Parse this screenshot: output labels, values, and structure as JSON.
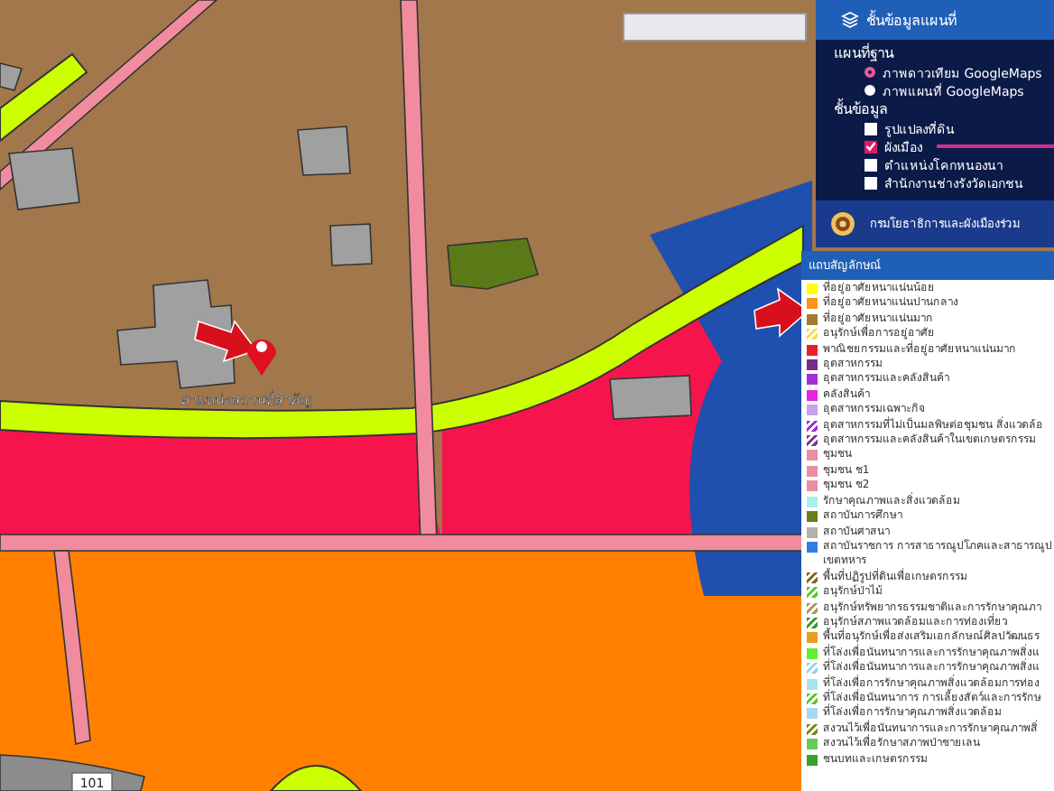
{
  "map": {
    "place_label": "ตำแหน่งสถานที่สำคัญ",
    "road_label": "101"
  },
  "layer_panel": {
    "title": "ชั้นข้อมูลแผนที่",
    "basemap_heading": "แผนที่ฐาน",
    "basemaps": [
      {
        "label": "ภาพดาวเทียม GoogleMaps",
        "selected": true
      },
      {
        "label": "ภาพแผนที่ GoogleMaps",
        "selected": false
      }
    ],
    "layers_heading": "ชั้นข้อมูล",
    "layers": [
      {
        "label": "รูปแปลงที่ดิน",
        "checked": false
      },
      {
        "label": "ผังเมือง",
        "checked": true
      },
      {
        "label": "ตำแหน่งโคกหนองนา",
        "checked": false
      },
      {
        "label": "สำนักงานช่างรังวัดเอกชน",
        "checked": false
      }
    ],
    "agency_banner": "กรมโยธาธิการและผังเมืองร่วม"
  },
  "legend": {
    "title": "แถบสัญลักษณ์",
    "items": [
      {
        "label": "ที่อยู่อาศัยหนาแน่นน้อย",
        "color": "#ffff00",
        "kind": "solid"
      },
      {
        "label": "ที่อยู่อาศัยหนาแน่นปานกลาง",
        "color": "#f7941d",
        "kind": "solid"
      },
      {
        "label": "ที่อยู่อาศัยหนาแน่นมาก",
        "color": "#a57a2a",
        "kind": "solid"
      },
      {
        "label": "อนุรักษ์เพื่อการอยู่อาศัย",
        "color": "#f5e03c",
        "kind": "hatched"
      },
      {
        "label": "พาณิชยกรรมและที่อยู่อาศัยหนาแน่นมาก",
        "color": "#e8202a",
        "kind": "solid"
      },
      {
        "label": "อุตสาหกรรม",
        "color": "#7a2a8c",
        "kind": "solid"
      },
      {
        "label": "อุตสาหกรรมและคลังสินค้า",
        "color": "#a030d8",
        "kind": "solid"
      },
      {
        "label": "คลังสินค้า",
        "color": "#e824e0",
        "kind": "solid"
      },
      {
        "label": "อุตสาหกรรมเฉพาะกิจ",
        "color": "#c8a2e6",
        "kind": "solid"
      },
      {
        "label": "อุตสาหกรรมที่ไม่เป็นมลพิษต่อชุมชน สิ่งแวดล้อ",
        "color": "#a030d8",
        "kind": "hatched"
      },
      {
        "label": "อุตสาหกรรมและคลังสินค้าในเขตเกษตรกรรม",
        "color": "#7a3a8c",
        "kind": "hatched"
      },
      {
        "label": "ชุมชน",
        "color": "#e8909c",
        "kind": "solid"
      },
      {
        "label": "ชุมชน ช1",
        "color": "#e8909c",
        "kind": "solid"
      },
      {
        "label": "ชุมชน ช2",
        "color": "#e8909c",
        "kind": "solid"
      },
      {
        "label": "รักษาคุณภาพและสิ่งแวดล้อม",
        "color": "#a6f2ee",
        "kind": "solid"
      },
      {
        "label": "สถาบันการศึกษา",
        "color": "#6b7d1c",
        "kind": "solid"
      },
      {
        "label": "สถาบันศาสนา",
        "color": "#b4b0ac",
        "kind": "solid"
      },
      {
        "label": "สถาบันราชการ การสาธารณูปโภคและสาธารณูป เขตทหาร",
        "color": "#2f80e6",
        "kind": "solid"
      },
      {
        "label": "พื้นที่ปฏิรูปที่ดินเพื่อเกษตรกรรม",
        "color": "#8a6418",
        "kind": "hatched"
      },
      {
        "label": "อนุรักษ์ป่าไม้",
        "color": "#5cc82c",
        "kind": "hatched"
      },
      {
        "label": "อนุรักษ์ทรัพยากรธรรมชาติและการรักษาคุณภา",
        "color": "#a89a60",
        "kind": "hatched"
      },
      {
        "label": "อนุรักษ์สภาพแวดล้อมและการท่องเที่ยว",
        "color": "#3a9a2a",
        "kind": "hatched"
      },
      {
        "label": "พื้นที่อนุรักษ์เพื่อส่งเสริมเอกลักษณ์ศิลปวัฒนธร",
        "color": "#e6a01e",
        "kind": "solid"
      },
      {
        "label": "ที่โล่งเพื่อนันทนาการและการรักษาคุณภาพสิ่งแ",
        "color": "#66ee33",
        "kind": "solid"
      },
      {
        "label": "ที่โล่งเพื่อนันทนาการและการรักษาคุณภาพสิ่งแ",
        "color": "#9ad0f0",
        "kind": "hatched"
      },
      {
        "label": "ที่โล่งเพื่อการรักษาคุณภาพสิ่งแวดล้อมการท่อง",
        "color": "#a6e6ee",
        "kind": "solid"
      },
      {
        "label": "ที่โล่งเพื่อนันทนาการ การเลี้ยงสัตว์และการรักษ",
        "color": "#5cc82c",
        "kind": "hatched"
      },
      {
        "label": "ที่โล่งเพื่อการรักษาคุณภาพสิ่งแวดล้อม",
        "color": "#a6d8f0",
        "kind": "solid"
      },
      {
        "label": "สงวนไว้เพื่อนันทนาการและการรักษาคุณภาพสิ่",
        "color": "#7a8a1c",
        "kind": "hatched"
      },
      {
        "label": "สงวนไว้เพื่อรักษาสภาพป่าชายเลน",
        "color": "#66cc55",
        "kind": "solid"
      },
      {
        "label": "ชนบทและเกษตรกรรม",
        "color": "#3aa02a",
        "kind": "solid"
      }
    ]
  }
}
